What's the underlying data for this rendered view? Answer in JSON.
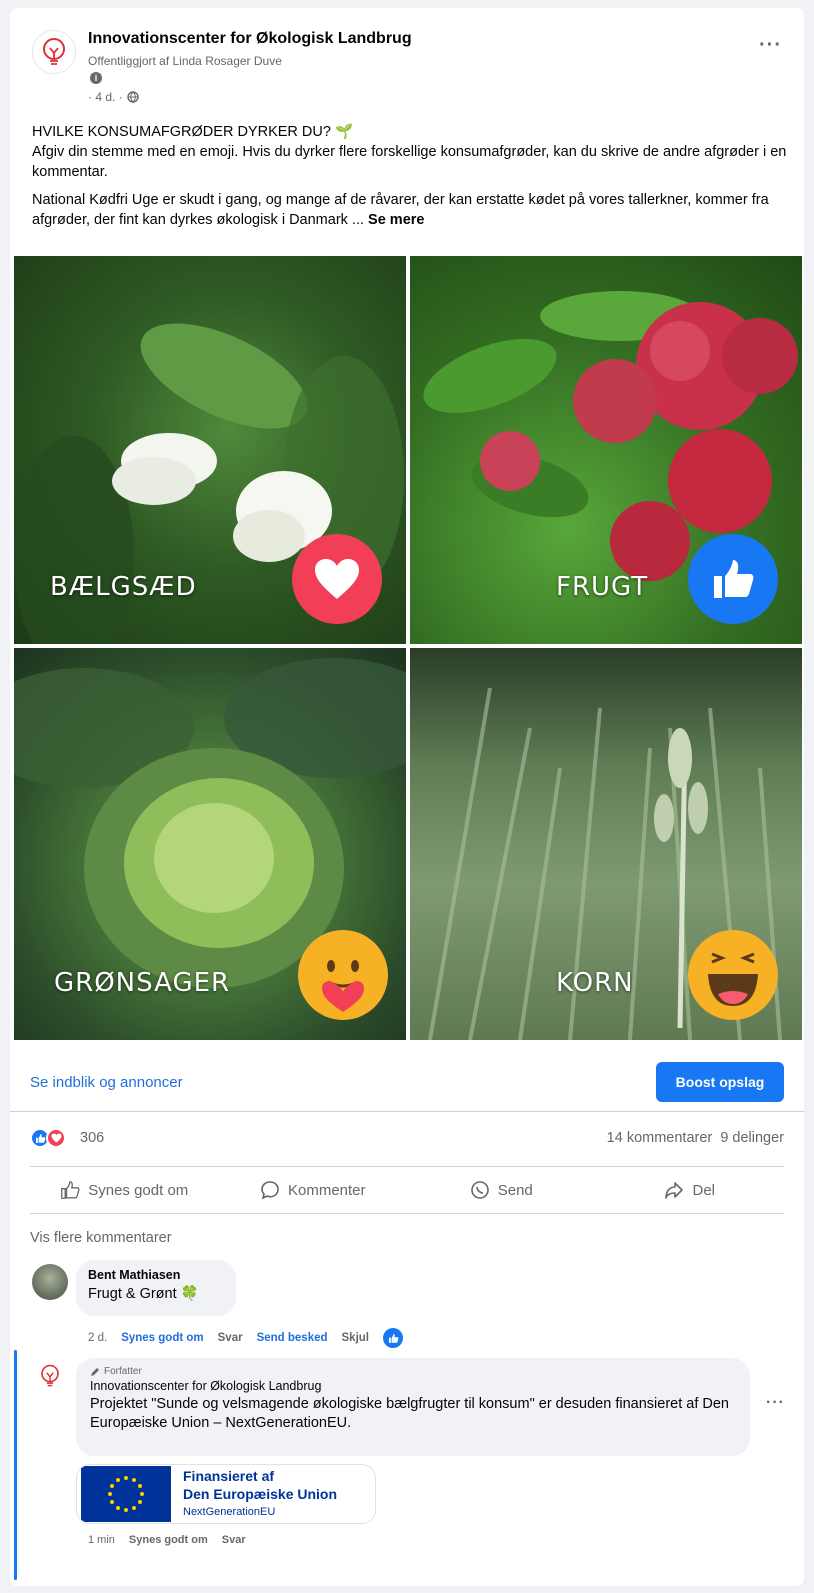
{
  "post": {
    "page_name": "Innovationscenter for Økologisk Landbrug",
    "published_by": "Offentliggjort af Linda Rosager Duve",
    "info_icon": "i",
    "time": "· 4 d. ·",
    "paragraph1_title": "HVILKE KONSUMAFGRØDER DYRKER DU? 🌱",
    "paragraph1_body": "Afgiv din stemme med en emoji. Hvis du dyrker flere forskellige konsumafgrøder, kan du skrive de andre afgrøder i en kommentar.",
    "paragraph2": "National Kødfri Uge er skudt i gang, og mange af de råvarer, der kan erstatte kødet på vores tallerkner, kommer fra afgrøder, der fint kan dyrkes økologisk i Danmark ...",
    "see_more": "Se mere",
    "tiles": [
      {
        "label": "BÆLGSÆD",
        "emoji": "love-reaction-icon",
        "color": "#f33e58"
      },
      {
        "label": "FRUGT",
        "emoji": "like-reaction-icon",
        "color": "#1877f2"
      },
      {
        "label": "GRØNSAGER",
        "emoji": "care-reaction-icon",
        "color": "#f7b125"
      },
      {
        "label": "KORN",
        "emoji": "haha-reaction-icon",
        "color": "#f7b125"
      }
    ]
  },
  "actions": {
    "insights": "Se indblik og annoncer",
    "boost": "Boost opslag"
  },
  "stats": {
    "reactions": "306",
    "comments": "14 kommentarer",
    "shares": "9 delinger"
  },
  "buttons": {
    "like": "Synes godt om",
    "comment": "Kommenter",
    "send": "Send",
    "share": "Del"
  },
  "comments": {
    "more": "Vis flere kommentarer",
    "c1": {
      "name": "Bent Mathiasen",
      "text": "Frugt & Grønt 🍀",
      "time": "2 d.",
      "like": "Synes godt om",
      "reply": "Svar",
      "message": "Send besked",
      "hide": "Skjul"
    },
    "c2": {
      "author_tag": "Forfatter",
      "name": "Innovationscenter for Økologisk Landbrug",
      "text": "Projektet \"Sunde og velsmagende økologiske bælgfrugter til konsum\" er desuden finansieret af Den Europæiske Union – NextGenerationEU.",
      "eu_line1": "Finansieret af",
      "eu_line2": "Den Europæiske Union",
      "eu_line3": "NextGenerationEU",
      "time": "1 min",
      "like": "Synes godt om",
      "reply": "Svar"
    }
  },
  "colors": {
    "accent": "#1877f2",
    "link": "#216fdb",
    "eu_blue": "#003399"
  }
}
